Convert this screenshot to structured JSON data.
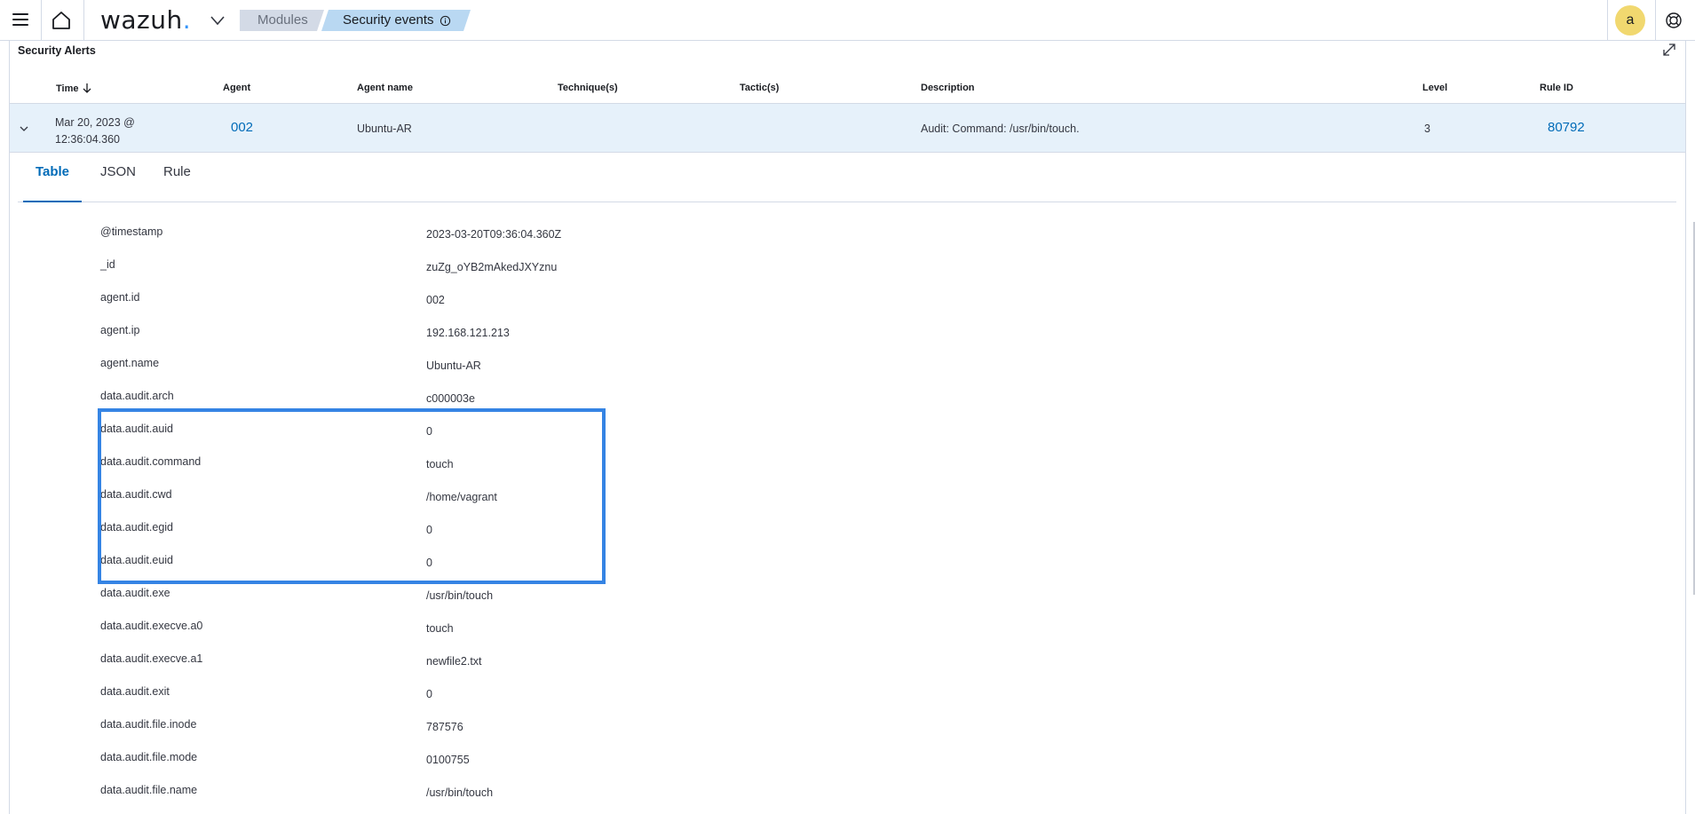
{
  "header": {
    "logo_text": "wazuh",
    "logo_dot": ".",
    "breadcrumbs": [
      "Modules",
      "Security events"
    ],
    "avatar_letter": "a",
    "accent_color": "#006bb8"
  },
  "panel": {
    "title": "Security Alerts"
  },
  "table": {
    "columns": [
      "Time",
      "Agent",
      "Agent name",
      "Technique(s)",
      "Tactic(s)",
      "Description",
      "Level",
      "Rule ID"
    ],
    "rows": [
      {
        "time_line1": "Mar 20, 2023 @",
        "time_line2": "12:36:04.360",
        "agent": "002",
        "agent_name": "Ubuntu-AR",
        "techniques": "",
        "tactics": "",
        "description": "Audit: Command: /usr/bin/touch.",
        "level": "3",
        "rule_id": "80792"
      }
    ]
  },
  "detail_tabs": [
    "Table",
    "JSON",
    "Rule"
  ],
  "fields": [
    {
      "key": "@timestamp",
      "value": "2023-03-20T09:36:04.360Z"
    },
    {
      "key": "_id",
      "value": "zuZg_oYB2mAkedJXYznu"
    },
    {
      "key": "agent.id",
      "value": "002"
    },
    {
      "key": "agent.ip",
      "value": "192.168.121.213"
    },
    {
      "key": "agent.name",
      "value": "Ubuntu-AR"
    },
    {
      "key": "data.audit.arch",
      "value": "c000003e"
    },
    {
      "key": "data.audit.auid",
      "value": "0"
    },
    {
      "key": "data.audit.command",
      "value": "touch"
    },
    {
      "key": "data.audit.cwd",
      "value": "/home/vagrant"
    },
    {
      "key": "data.audit.egid",
      "value": "0"
    },
    {
      "key": "data.audit.euid",
      "value": "0"
    },
    {
      "key": "data.audit.exe",
      "value": "/usr/bin/touch"
    },
    {
      "key": "data.audit.execve.a0",
      "value": "touch"
    },
    {
      "key": "data.audit.execve.a1",
      "value": "newfile2.txt"
    },
    {
      "key": "data.audit.exit",
      "value": "0"
    },
    {
      "key": "data.audit.file.inode",
      "value": "787576"
    },
    {
      "key": "data.audit.file.mode",
      "value": "0100755"
    },
    {
      "key": "data.audit.file.name",
      "value": "/usr/bin/touch"
    }
  ]
}
